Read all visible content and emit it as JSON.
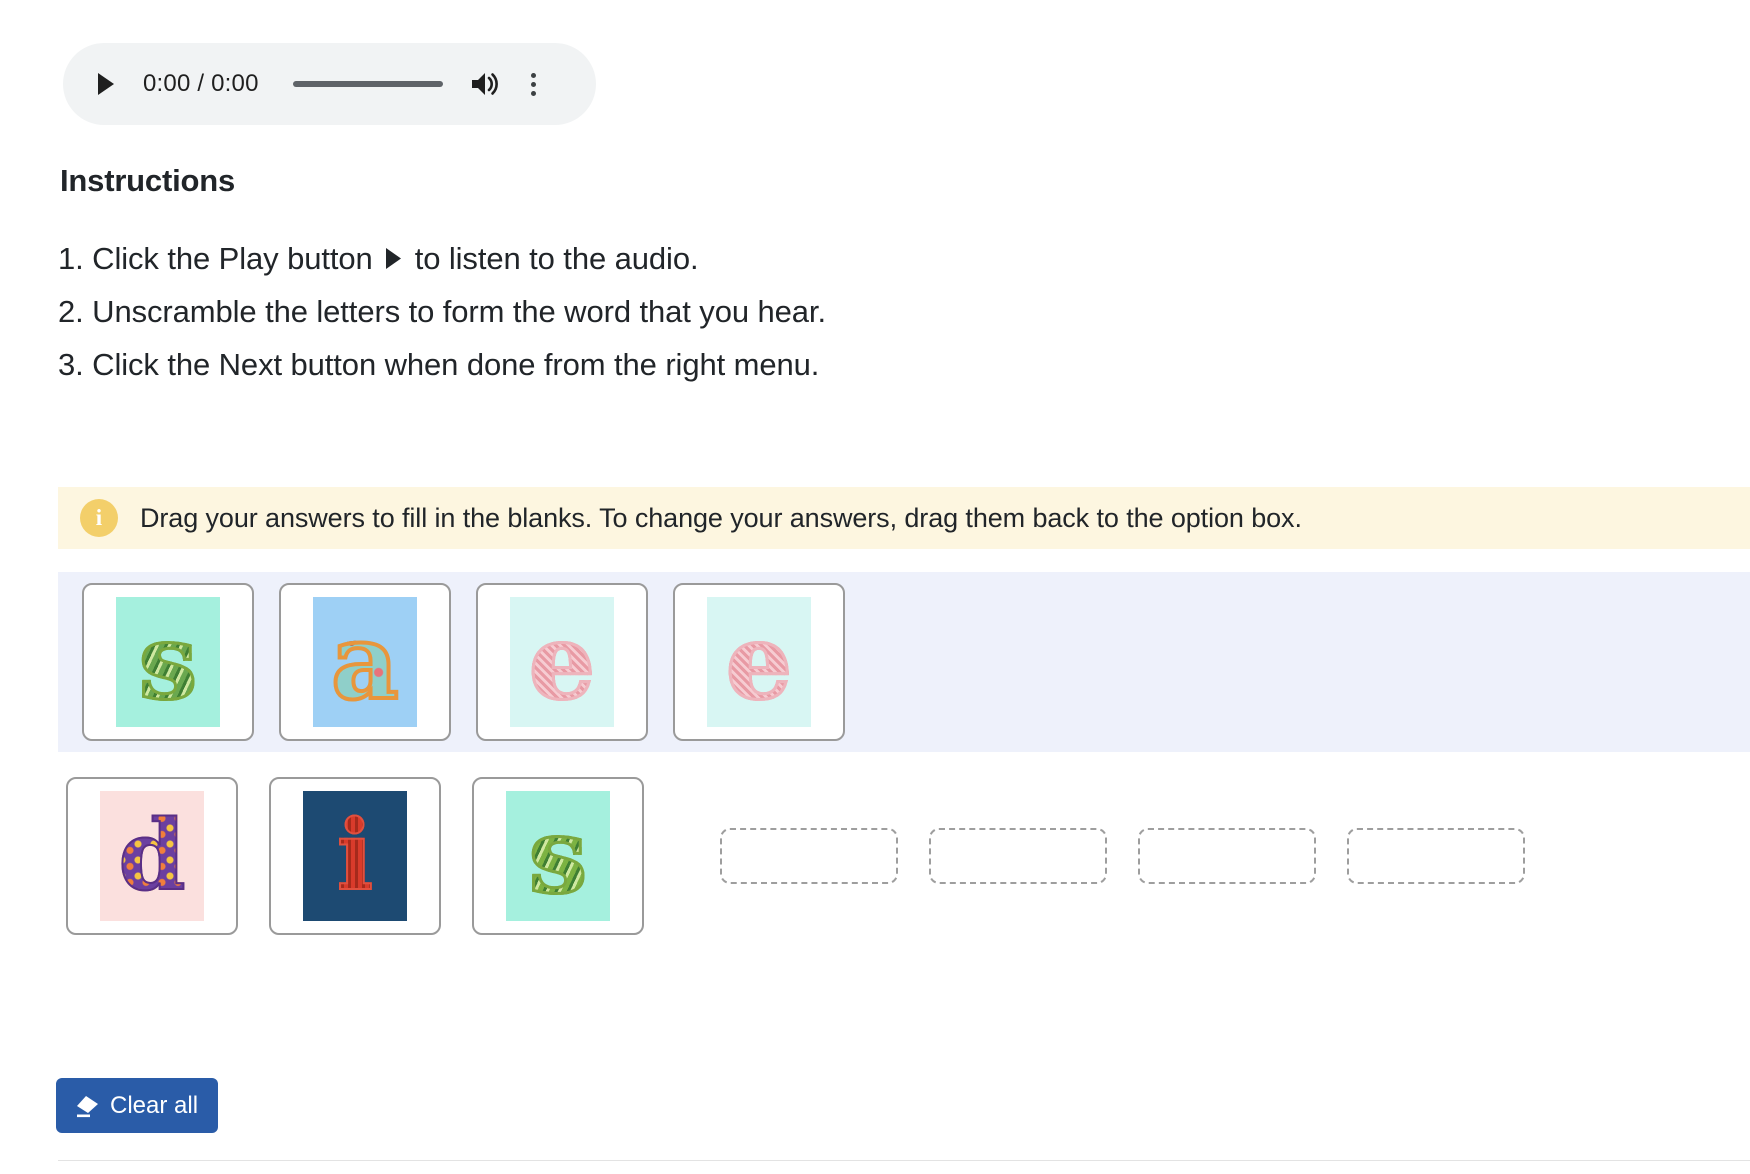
{
  "audio_player": {
    "play_label": "play-icon",
    "time_display": "0:00 / 0:00",
    "volume_label": "volume-icon",
    "menu_label": "more-options-icon"
  },
  "instructions": {
    "heading": "Instructions",
    "steps": [
      {
        "before": "1. Click the Play button",
        "has_play_glyph": true,
        "after": "to listen to the audio."
      },
      {
        "before": "2. Unscramble the letters to form the word that you hear.",
        "has_play_glyph": false,
        "after": ""
      },
      {
        "before": "3. Click the Next button when done from the right menu.",
        "has_play_glyph": false,
        "after": ""
      }
    ]
  },
  "info_banner": {
    "icon": "info-icon",
    "icon_glyph": "i",
    "text": "Drag your answers to fill in the blanks. To change your answers, drag them back to the option box.",
    "background_color": "#fdf6e0",
    "icon_color": "#f3cf6a"
  },
  "option_box": {
    "background_color": "#eef1fb",
    "tiles": [
      {
        "letter": "s",
        "bg": "#a5f0de",
        "color": "#6aa84f",
        "style": "leafy-green"
      },
      {
        "letter": "a",
        "bg": "#9ed0f5",
        "color": "#e8963c",
        "style": "floral-orange"
      },
      {
        "letter": "e",
        "bg": "#d8f6f3",
        "color": "#e89aa4",
        "style": "lace-pink"
      },
      {
        "letter": "e",
        "bg": "#d8f6f3",
        "color": "#e89aa4",
        "style": "lace-pink"
      }
    ]
  },
  "answer_row": {
    "tiles": [
      {
        "letter": "d",
        "bg": "#fbe0de",
        "color": "#6b3fa0",
        "style": "dotted-purple"
      },
      {
        "letter": "i",
        "bg": "#1d4a72",
        "color": "#d93b2b",
        "style": "red-on-navy"
      },
      {
        "letter": "s",
        "bg": "#a5f0de",
        "color": "#7cb342",
        "style": "leafy-green"
      }
    ],
    "blanks": [
      {
        "value": ""
      },
      {
        "value": ""
      },
      {
        "value": ""
      },
      {
        "value": ""
      }
    ]
  },
  "clear_button": {
    "label": "Clear all",
    "icon": "eraser-icon",
    "color": "#2a5ca8"
  }
}
